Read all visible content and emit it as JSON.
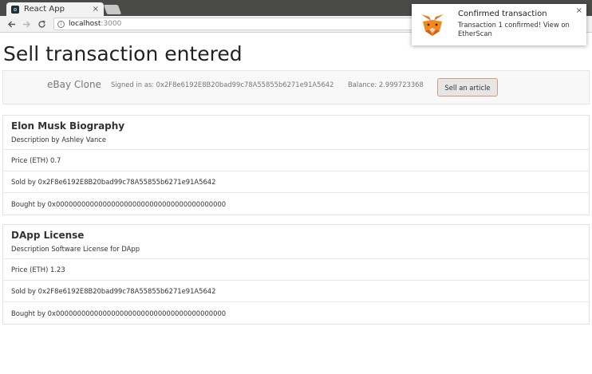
{
  "browser": {
    "tab_title": "React App",
    "tab_close": "×",
    "url_host": "localhost",
    "url_port": ":3000",
    "back_icon": "arrow-left",
    "forward_icon": "arrow-right",
    "reload_icon": "reload"
  },
  "page": {
    "title": "Sell transaction entered"
  },
  "navbar": {
    "brand": "eBay Clone",
    "signed_in": "Signed in as: 0x2F8e6192E8B20bad99c78A55855b6271e91A5642",
    "balance": "Balance: 2.999723368",
    "sell_button": "Sell an article"
  },
  "articles": [
    {
      "name": "Elon Musk Biography",
      "description": "Description by Ashley Vance",
      "price": "Price (ETH) 0.7",
      "seller": "Sold by 0x2F8e6192E8B20bad99c78A55855b6271e91A5642",
      "buyer": "Bought by 0x0000000000000000000000000000000000000000"
    },
    {
      "name": "DApp License",
      "description": "Description Software License for DApp",
      "price": "Price (ETH) 1.23",
      "seller": "Sold by 0x2F8e6192E8B20bad99c78A55855b6271e91A5642",
      "buyer": "Bought by 0x0000000000000000000000000000000000000000"
    }
  ],
  "notification": {
    "title": "Confirmed transaction",
    "body": "Transaction 1 confirmed! View on EtherScan",
    "close": "×",
    "icon": "metamask-fox-icon",
    "accent_colors": [
      "#e2761b",
      "#f6851b",
      "#cd6116"
    ]
  }
}
